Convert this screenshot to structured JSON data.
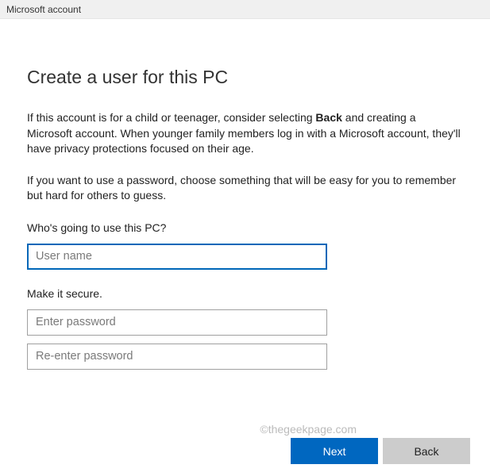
{
  "window": {
    "title": "Microsoft account"
  },
  "page": {
    "heading": "Create a user for this PC",
    "paragraph1_pre": "If this account is for a child or teenager, consider selecting ",
    "paragraph1_bold": "Back",
    "paragraph1_post": " and creating a Microsoft account. When younger family members log in with a Microsoft account, they'll have privacy protections focused on their age.",
    "paragraph2": "If you want to use a password, choose something that will be easy for you to remember but hard for others to guess."
  },
  "form": {
    "who_label": "Who's going to use this PC?",
    "username_placeholder": "User name",
    "secure_label": "Make it secure.",
    "password_placeholder": "Enter password",
    "repassword_placeholder": "Re-enter password"
  },
  "buttons": {
    "next": "Next",
    "back": "Back"
  },
  "watermark": "©thegeekpage.com"
}
